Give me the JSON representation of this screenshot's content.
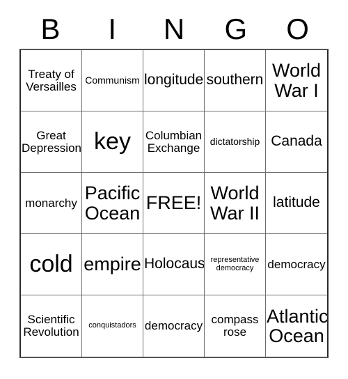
{
  "card": {
    "title": "BINGO",
    "header_letters": [
      "B",
      "I",
      "N",
      "G",
      "O"
    ],
    "free_space_label": "FREE!",
    "colors": {
      "text": "#000000",
      "grid_line": "#6e6e6e",
      "grid_border": "#2b2b2b",
      "background": "#ffffff"
    },
    "rows": [
      [
        {
          "label": "Treaty of\nVersailles",
          "size": "md",
          "free": false
        },
        {
          "label": "Communism",
          "size": "sm",
          "free": false
        },
        {
          "label": "longitude",
          "size": "lg",
          "free": false
        },
        {
          "label": "southern",
          "size": "lg",
          "free": false
        },
        {
          "label": "World\nWar I",
          "size": "xl",
          "free": false
        }
      ],
      [
        {
          "label": "Great\nDepression",
          "size": "md",
          "free": false
        },
        {
          "label": "key",
          "size": "xxl",
          "free": false
        },
        {
          "label": "Columbian\nExchange",
          "size": "md",
          "free": false
        },
        {
          "label": "dictatorship",
          "size": "sm",
          "free": false
        },
        {
          "label": "Canada",
          "size": "lg",
          "free": false
        }
      ],
      [
        {
          "label": "monarchy",
          "size": "md",
          "free": false
        },
        {
          "label": "Pacific\nOcean",
          "size": "xl",
          "free": false
        },
        {
          "label": "FREE!",
          "size": "xl",
          "free": true
        },
        {
          "label": "World\nWar II",
          "size": "xl",
          "free": false
        },
        {
          "label": "latitude",
          "size": "lg",
          "free": false
        }
      ],
      [
        {
          "label": "cold",
          "size": "xxl",
          "free": false
        },
        {
          "label": "empire",
          "size": "xl",
          "free": false
        },
        {
          "label": "Holocaust",
          "size": "lg",
          "free": false
        },
        {
          "label": "representative\ndemocracy",
          "size": "xs",
          "free": false
        },
        {
          "label": "democracy",
          "size": "md",
          "free": false
        }
      ],
      [
        {
          "label": "Scientific\nRevolution",
          "size": "md",
          "free": false
        },
        {
          "label": "conquistadors",
          "size": "xs",
          "free": false
        },
        {
          "label": "democracy",
          "size": "md",
          "free": false
        },
        {
          "label": "compass\nrose",
          "size": "md",
          "free": false
        },
        {
          "label": "Atlantic\nOcean",
          "size": "xl",
          "free": false
        }
      ]
    ]
  }
}
